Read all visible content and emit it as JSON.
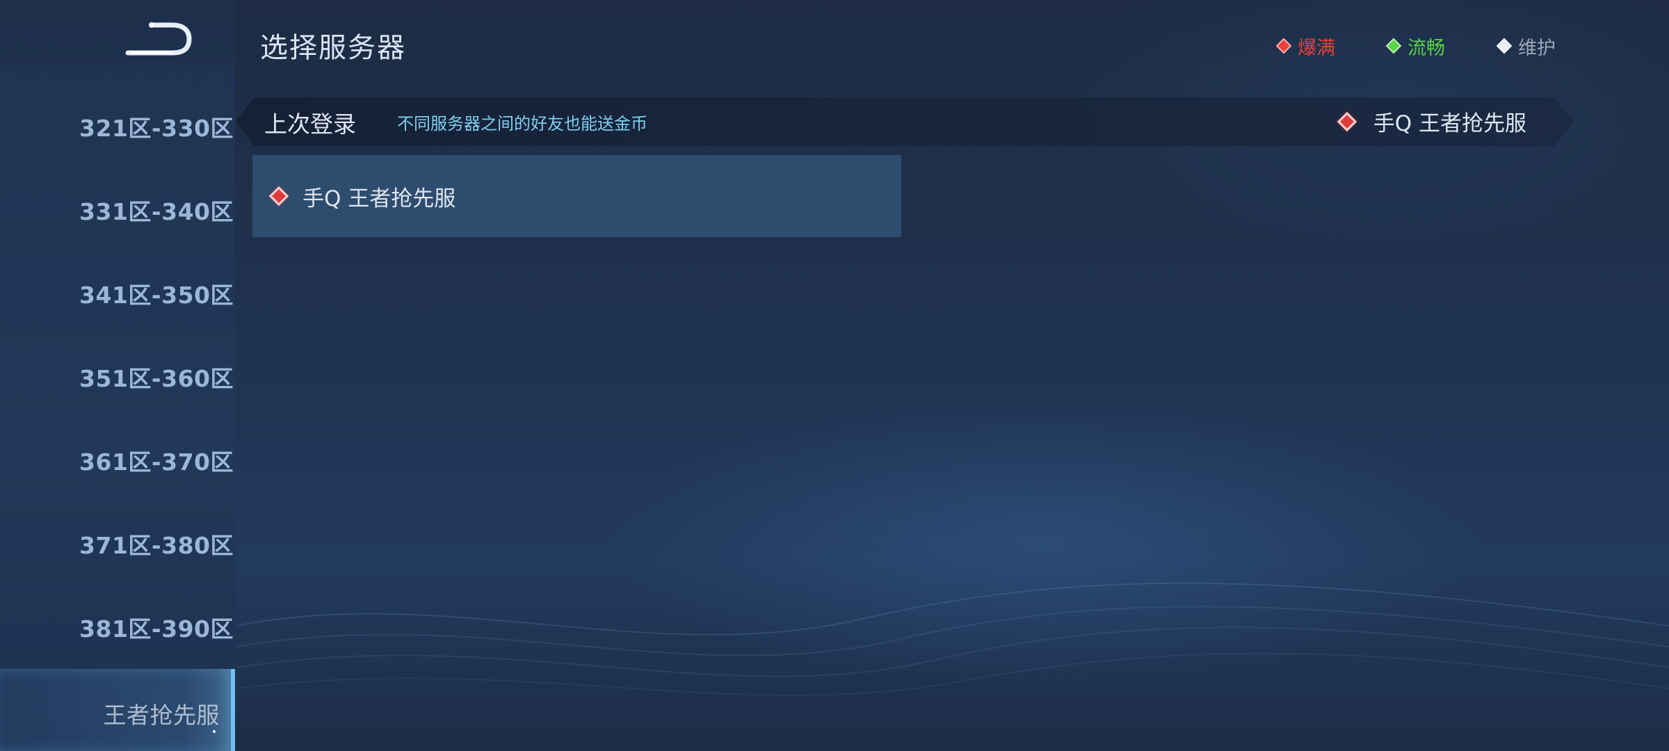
{
  "header": {
    "title": "选择服务器"
  },
  "legend": [
    {
      "label": "爆满",
      "color": "#e8403a"
    },
    {
      "label": "流畅",
      "color": "#5ad24a"
    },
    {
      "label": "维护",
      "color": "#9aa6b6"
    }
  ],
  "sidebar": {
    "back_icon": "back-arrow-icon",
    "items": [
      {
        "label": "321区-330区"
      },
      {
        "label": "331区-340区"
      },
      {
        "label": "341区-350区"
      },
      {
        "label": "351区-360区"
      },
      {
        "label": "361区-370区"
      },
      {
        "label": "371区-380区"
      },
      {
        "label": "381区-390区"
      },
      {
        "label": "王者抢先服",
        "active": true
      }
    ]
  },
  "last_login": {
    "label": "上次登录",
    "hint": "不同服务器之间的好友也能送金币",
    "server": "手Q 王者抢先服",
    "status_color": "#e23a3a"
  },
  "servers": [
    {
      "name": "手Q 王者抢先服",
      "status_color": "#e23a3a"
    }
  ]
}
